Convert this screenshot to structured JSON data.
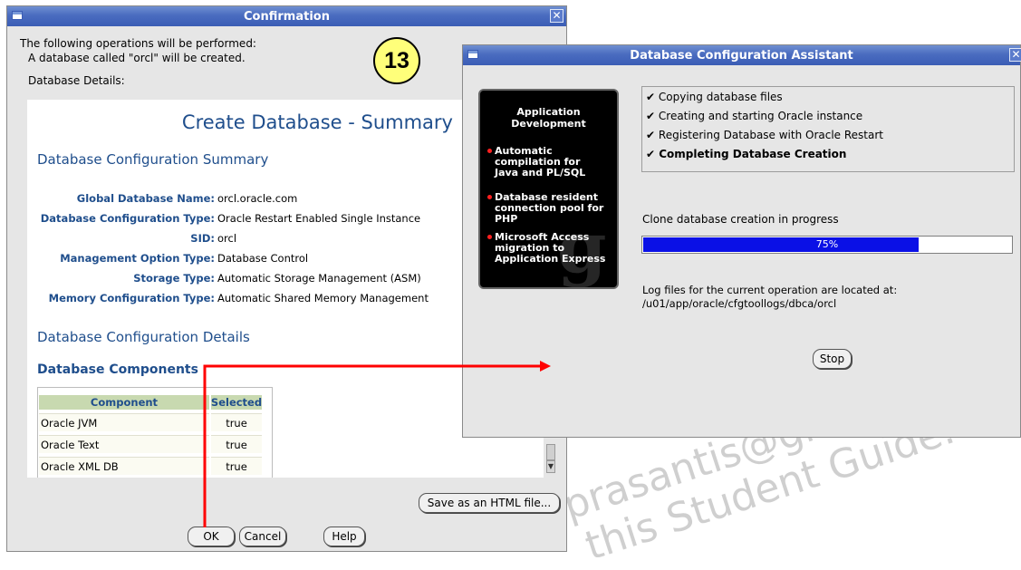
{
  "confirmation": {
    "title": "Confirmation",
    "intro_line": "The following operations will be performed:",
    "db_line": "A database called \"orcl\" will be created.",
    "details_label": "Database Details:",
    "step_badge": "13",
    "summary": {
      "title": "Create Database - Summary",
      "config_summary_heading": "Database Configuration Summary",
      "fields": [
        {
          "label": "Global Database Name:",
          "value": "orcl.oracle.com"
        },
        {
          "label": "Database Configuration Type:",
          "value": "Oracle Restart Enabled Single Instance"
        },
        {
          "label": "SID:",
          "value": "orcl"
        },
        {
          "label": "Management Option Type:",
          "value": "Database Control"
        },
        {
          "label": "Storage Type:",
          "value": "Automatic Storage Management (ASM)"
        },
        {
          "label": "Memory Configuration Type:",
          "value": "Automatic Shared Memory Management"
        }
      ],
      "details_heading": "Database Configuration Details",
      "components_heading": "Database Components",
      "components_table": {
        "headers": [
          "Component",
          "Selected"
        ],
        "rows": [
          [
            "Oracle JVM",
            "true"
          ],
          [
            "Oracle Text",
            "true"
          ],
          [
            "Oracle XML DB",
            "true"
          ]
        ]
      }
    },
    "buttons": {
      "save_html": "Save as an HTML file...",
      "ok": "OK",
      "cancel": "Cancel",
      "help": "Help"
    }
  },
  "dbca": {
    "title": "Database Configuration Assistant",
    "ad_panel": {
      "title_line1": "Application",
      "title_line2": "Development",
      "items": [
        {
          "l1": "Automatic",
          "l2": "compilation for",
          "l3": "Java and PL/SQL"
        },
        {
          "l1": "Database resident",
          "l2": "connection pool for",
          "l3": "PHP"
        },
        {
          "l1": "Microsoft Access",
          "l2": "migration to",
          "l3": "Application Express"
        }
      ],
      "watermark": "g"
    },
    "steps": [
      {
        "check": "✔",
        "label": "Copying database files"
      },
      {
        "check": "✔",
        "label": "Creating and starting Oracle instance"
      },
      {
        "check": "✔",
        "label": "Registering Database with Oracle Restart"
      },
      {
        "check": "✔",
        "label": "Completing Database Creation"
      }
    ],
    "status_text": "Clone database creation in progress",
    "progress": {
      "percent": 75,
      "label": "75%"
    },
    "log_line1": "Log files for the current operation are located at:",
    "log_line2": "/u01/app/oracle/cfgtoollogs/dbca/orcl",
    "stop_button": "Stop"
  },
  "annotation_arrow_color": "#ff0000",
  "watermark": {
    "line1": "(rtaprasantis@gmail.com) has",
    "line2": "this Student Guide."
  }
}
